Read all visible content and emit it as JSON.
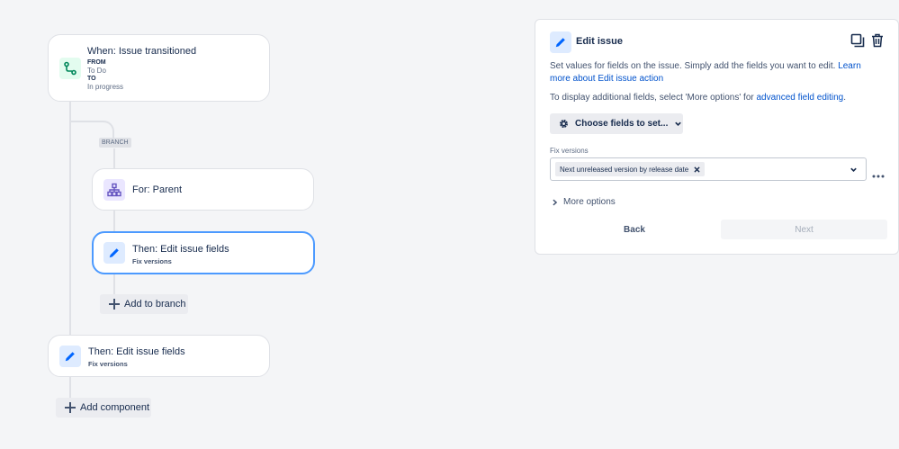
{
  "trigger": {
    "title": "When: Issue transitioned",
    "from_label": "FROM",
    "from_value": "To Do",
    "to_label": "TO",
    "to_value": "In progress"
  },
  "branch": {
    "badge": "BRANCH",
    "for_title": "For: Parent",
    "action_title": "Then: Edit issue fields",
    "action_sub": "Fix versions",
    "add_label": "Add to branch"
  },
  "action2": {
    "title": "Then: Edit issue fields",
    "sub": "Fix versions"
  },
  "add_component_label": "Add component",
  "panel": {
    "title": "Edit issue",
    "desc_text": "Set values for fields on the issue. Simply add the fields you want to edit.",
    "desc_link": "Learn more about Edit issue action",
    "display_text": "To display additional fields, select 'More options' for",
    "display_link": "advanced field editing",
    "display_end": ".",
    "choose_label": "Choose fields to set...",
    "field_label": "Fix versions",
    "chip_label": "Next unreleased version by release date",
    "more_options": "More options",
    "back_label": "Back",
    "next_label": "Next"
  },
  "colors": {
    "accent": "#0052cc",
    "selected_border": "#4c9aff",
    "trigger_tile": "#e3fcef",
    "trigger_icon": "#00875a",
    "branch_tile": "#eae6ff",
    "branch_icon": "#6554c0",
    "action_tile": "#deebff",
    "action_icon": "#0065ff"
  }
}
